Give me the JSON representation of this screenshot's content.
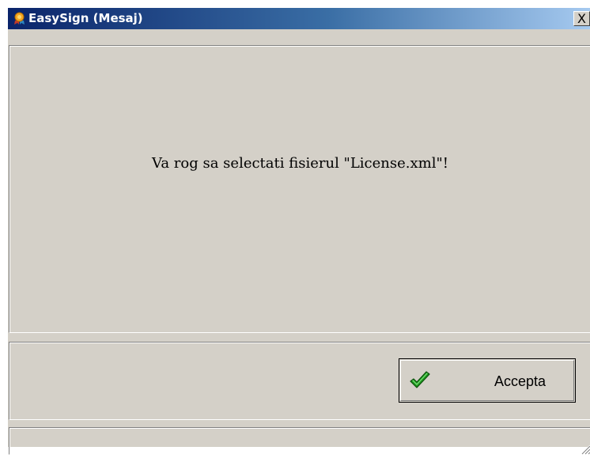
{
  "window": {
    "title": "EasySign (Mesaj)",
    "close_label": "X"
  },
  "message": {
    "text": "Va rog sa selectati fisierul \"License.xml\"!"
  },
  "actions": {
    "accept_label": "Accepta"
  },
  "icons": {
    "app": "easysign-app-icon",
    "close": "close-icon",
    "accept": "green-checkmark-icon",
    "grip": "resize-grip-icon"
  },
  "colors": {
    "titlebar_start": "#0a246a",
    "titlebar_end": "#a6caf0",
    "window_bg": "#d4d0c8",
    "check_green": "#1e9a1e"
  }
}
